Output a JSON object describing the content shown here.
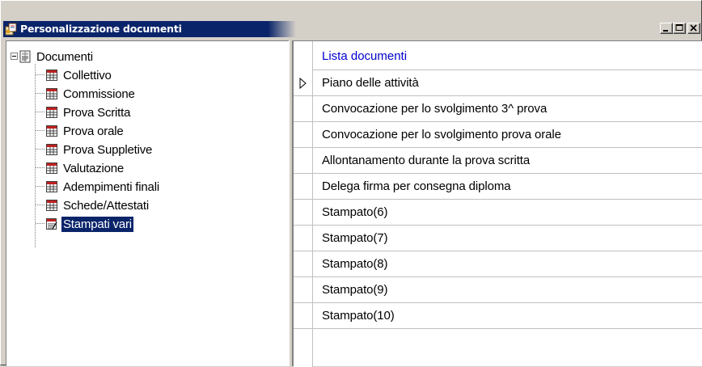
{
  "window": {
    "title": "Personalizzazione documenti",
    "controls": {
      "minimize": "_",
      "maximize": "□",
      "close": "×"
    }
  },
  "tree": {
    "root": {
      "label": "Documenti",
      "icon": "document-book-icon",
      "expanded": true
    },
    "children": [
      {
        "label": "Collettivo",
        "icon": "table-grid-icon"
      },
      {
        "label": "Commissione",
        "icon": "table-grid-icon"
      },
      {
        "label": "Prova Scritta",
        "icon": "table-grid-icon"
      },
      {
        "label": "Prova orale",
        "icon": "table-grid-icon"
      },
      {
        "label": "Prova Suppletive",
        "icon": "table-grid-icon"
      },
      {
        "label": "Valutazione",
        "icon": "table-grid-icon"
      },
      {
        "label": "Adempimenti finali",
        "icon": "table-grid-icon"
      },
      {
        "label": "Schede/Attestati",
        "icon": "table-grid-icon"
      },
      {
        "label": "Stampati vari",
        "icon": "printed-forms-icon",
        "selected": true
      }
    ]
  },
  "list": {
    "header": "Lista documenti",
    "current_row_indicator": "triangle-right-icon",
    "rows": [
      "Piano delle attività",
      "Convocazione per lo svolgimento 3^ prova",
      "Convocazione per lo svolgimento prova orale",
      "Allontanamento durante la prova scritta",
      "Delega firma per consegna diploma",
      "Stampato(6)",
      "Stampato(7)",
      "Stampato(8)",
      "Stampato(9)",
      "Stampato(10)"
    ]
  },
  "colors": {
    "title_active": "#0a246a",
    "selection": "#0a246a",
    "header_text": "#0000cc",
    "face": "#d4d0c8"
  }
}
